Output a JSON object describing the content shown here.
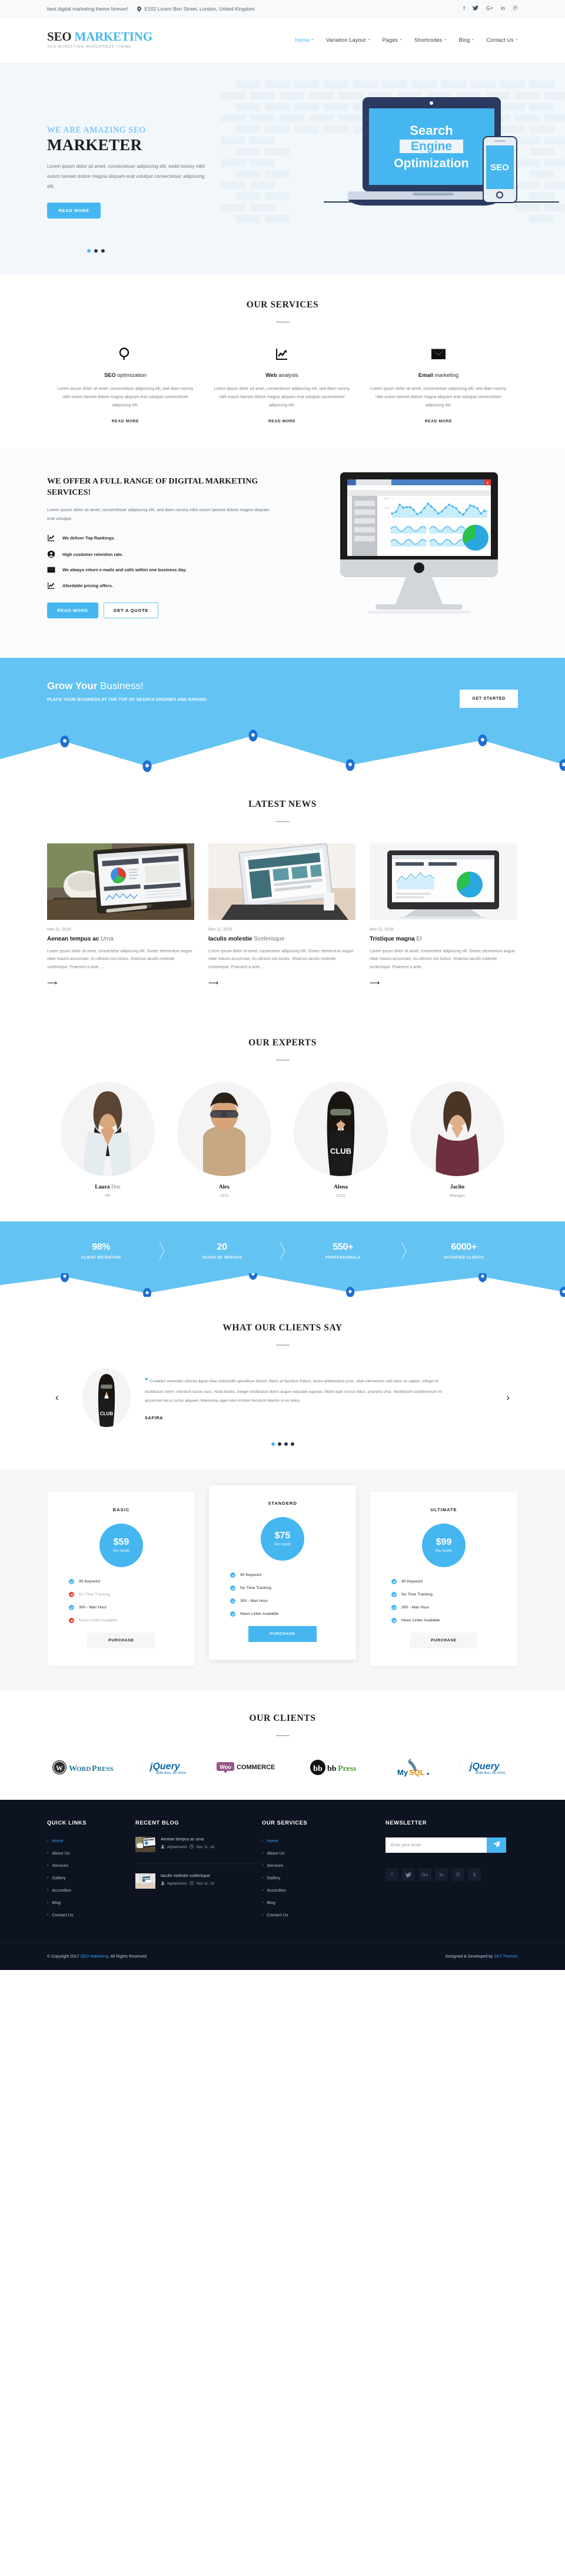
{
  "topbar": {
    "tagline": "best digital marketing theme forever!",
    "address": "E102 Lorem Ben Street, London, United Kingdom",
    "social": [
      {
        "name": "facebook-icon",
        "glyph": "f"
      },
      {
        "name": "twitter-icon",
        "glyph": "✉"
      },
      {
        "name": "google-plus-icon",
        "glyph": "G+"
      },
      {
        "name": "linkedin-icon",
        "glyph": "in"
      },
      {
        "name": "pinterest-icon",
        "glyph": "Ⓟ"
      }
    ]
  },
  "header": {
    "logo_main": "SEO ",
    "logo_accent": "MARKETING",
    "logo_sub": "SEO MARKETING WORDPRESS THEME",
    "nav": [
      {
        "label": "Home",
        "active": true,
        "caret": true
      },
      {
        "label": "Variation Layout",
        "active": false,
        "caret": true
      },
      {
        "label": "Pages",
        "active": false,
        "caret": true
      },
      {
        "label": "Shortcodes",
        "active": false,
        "caret": true
      },
      {
        "label": "Blog",
        "active": false,
        "caret": true
      },
      {
        "label": "Contact Us",
        "active": false,
        "caret": true
      }
    ]
  },
  "hero": {
    "kicker": "WE ARE AMAZING SEO",
    "title": "MARKETER",
    "paragraph": "Lorem ipsum dolor sit amet, consectetuer adipiscing elit, sedd nonmy nibh euism laoreet dolore magna aliquam erat volutpat consectetuer adipiscing elit.",
    "cta": "READ MORE",
    "art_line1": "Search",
    "art_line2": "Engine",
    "art_line3": "Optimization",
    "art_phone": "SEO",
    "slides": 3,
    "active_slide": 1
  },
  "services": {
    "title": "OUR SERVICES",
    "items": [
      {
        "icon": "search-icon",
        "title_bold": "SEO",
        "title_rest": " optimization",
        "text": "Lorem ipsum dolor sit amet, consectetuer adipiscing elit, sed diam nonmy nibh euism laoreet dolore magna aliquam erat volutpat consectetuer adipiscing elit.",
        "link": "READ MORE"
      },
      {
        "icon": "chart-line-icon",
        "title_bold": "Web",
        "title_rest": " analysis",
        "text": "Lorem ipsum dolor sit amet, consectetuer adipiscing elit, sed diam nonmy nibh euism laoreet dolore magna aliquam erat volutpat consectetuer adipiscing elit.",
        "link": "READ MORE"
      },
      {
        "icon": "envelope-icon",
        "title_bold": "Email",
        "title_rest": " marketing",
        "text": "Lorem ipsum dolor sit amet, consectetuer adipiscing elit, sed diam nonmy nibh euism laoreet dolore magna aliquam erat volutpat consectetuer adipiscing elit.",
        "link": "READ MORE"
      }
    ]
  },
  "fullrange": {
    "heading": "WE OFFER A FULL RANGE OF DIGITAL MARKETING SERVICES!",
    "paragraph": "Lorem ipsum dolor sit amet, consectetuer adipiscing elit, sed diam nonmy nibh euism laoreet dolore magna aliquam erat volutpat.",
    "points": [
      {
        "icon": "chart-line-icon",
        "text": "We deliver Top Rankings."
      },
      {
        "icon": "user-circle-icon",
        "text": "High customer retention rate."
      },
      {
        "icon": "envelope-icon",
        "text": "We always return e-mails and calls within one business day."
      },
      {
        "icon": "chart-line-icon",
        "text": "Afordable pricing offers."
      }
    ],
    "btn_primary": "READ MORE",
    "btn_secondary": "GET A QUOTE"
  },
  "grow": {
    "title_bold": "Grow Your ",
    "title_rest": "Business!",
    "subtitle": "PLACE YOUR BUSINESS AT THE TOP OF SEARCH ENGINES AND EXPAND.",
    "cta": "GET STARTED"
  },
  "news": {
    "title": "LATEST NEWS",
    "items": [
      {
        "date": "Nov 11, 2016",
        "title_bold": "Aenean tempus ac ",
        "title_rest": "Urna",
        "text": "Lorem ipsum dolor sit amet, consectetur adipiscing elit. Donec elementum augue vitae mauris accumsan, eu ultrices nisi luctus. Vivamus iaculis molestie scelerisque. Praesent a ante…"
      },
      {
        "date": "Nov 11, 2016",
        "title_bold": "Iaculis molestie ",
        "title_rest": "Scelerisque",
        "text": "Lorem ipsum dolor sit amet, consectetur adipiscing elit. Donec elementum augue vitae mauris accumsan, eu ultrices nisi luctus. Vivamus iaculis molestie scelerisque. Praesent a ante…"
      },
      {
        "date": "Nov 11, 2016",
        "title_bold": "Tristique magna ",
        "title_rest": "Et",
        "text": "Lorem ipsum dolor sit amet, consectetur adipiscing elit. Donec elementum augue vitae mauris accumsan, eu ultrices nisi luctus. Vivamus iaculis molestie scelerisque. Praesent a ante…"
      }
    ]
  },
  "experts": {
    "title": "OUR EXPERTS",
    "items": [
      {
        "name_bold": "Laura ",
        "name_rest": "Doe",
        "role": "HR"
      },
      {
        "name_bold": "Alex",
        "name_rest": "",
        "role": "CEO"
      },
      {
        "name_bold": "Alena",
        "name_rest": "",
        "role": "CCO"
      },
      {
        "name_bold": "Jaclin",
        "name_rest": "",
        "role": "Manager"
      }
    ]
  },
  "counters": [
    {
      "number": "98%",
      "label": "CLIENT RETENTION"
    },
    {
      "number": "20",
      "label": "YEARS OF SERVICE"
    },
    {
      "number": "550+",
      "label": "PROFESSIONALS"
    },
    {
      "number": "6000+",
      "label": "SATISFIED CLIENTS"
    }
  ],
  "testimonial": {
    "title": "WHAT OUR CLIENTS SAY",
    "quote": "Curabitur venenatis ultricies ligula vitae sollicitudin spendisse dictum, libero at faucibus finibus, lectus arbibendum justo, vitae elementum velit dolor ac sapien. Integer id vestibulum lorem, interdum luctus nunc. Nulla facilisi. Integer vestibulum libero augue vulputate egestas. Morbi eget cursus tellus, pharetra urna. Vestibulum condimentum mi accumsan lacus luctus aliquam. Maecenas eget nunc id dolor tincidunt lobortis ut eu tellus.",
    "author": "SAFIRA",
    "prev": "‹",
    "next": "›",
    "dots": 4,
    "active_dot": 1
  },
  "pricing": {
    "plans": [
      {
        "name": "BASIC",
        "amount": "$59",
        "per": "Per month",
        "featured": false,
        "features": [
          {
            "text": "90 Keyword",
            "ok": true
          },
          {
            "text": "No Time Tracking",
            "ok": false
          },
          {
            "text": "300 - Man Hour",
            "ok": true
          },
          {
            "text": "News Letter Available",
            "ok": false
          }
        ],
        "cta": "PURCHASE"
      },
      {
        "name": "STANDERD",
        "amount": "$75",
        "per": "Per month",
        "featured": true,
        "features": [
          {
            "text": "90 Keyword",
            "ok": true
          },
          {
            "text": "No Time Tracking",
            "ok": true
          },
          {
            "text": "300 - Man Hour",
            "ok": true
          },
          {
            "text": "News Letter Available",
            "ok": true
          }
        ],
        "cta": "PURCHASE"
      },
      {
        "name": "ULTIMATE",
        "amount": "$99",
        "per": "Per month",
        "featured": false,
        "features": [
          {
            "text": "90 Keyword",
            "ok": true
          },
          {
            "text": "No Time Tracking",
            "ok": true
          },
          {
            "text": "300 - Man Hour",
            "ok": true
          },
          {
            "text": "News Letter Available",
            "ok": true
          }
        ],
        "cta": "PURCHASE"
      }
    ]
  },
  "clients": {
    "title": "OUR CLIENTS",
    "logos": [
      "WordPress",
      "jQuery",
      "WooCommerce",
      "bbPress",
      "MySQL",
      "jQuery"
    ]
  },
  "footer": {
    "quick_links": {
      "heading": "QUICK LINKS",
      "items": [
        {
          "label": "Home",
          "active": true
        },
        {
          "label": "About Us",
          "active": false
        },
        {
          "label": "Services",
          "active": false
        },
        {
          "label": "Gallery",
          "active": false
        },
        {
          "label": "Accordion",
          "active": false
        },
        {
          "label": "Blog",
          "active": false
        },
        {
          "label": "Contact Us",
          "active": false
        }
      ]
    },
    "recent_blog": {
      "heading": "RECENT BLOG",
      "items": [
        {
          "title": "Aenean tempus ac urna",
          "author": "digitalmark1",
          "date": "Nov 11, 16"
        },
        {
          "title": "Iaculis molestie scelerisque",
          "author": "digitalmark1",
          "date": "Nov 11, 16"
        }
      ]
    },
    "our_services": {
      "heading": "OUR SERVICES",
      "items": [
        {
          "label": "Home",
          "active": true
        },
        {
          "label": "About Us",
          "active": false
        },
        {
          "label": "Services",
          "active": false
        },
        {
          "label": "Gallery",
          "active": false
        },
        {
          "label": "Accordion",
          "active": false
        },
        {
          "label": "Blog",
          "active": false
        },
        {
          "label": "Contact Us",
          "active": false
        }
      ]
    },
    "newsletter": {
      "heading": "NEWSLETTER",
      "placeholder": "Enter your email",
      "send_icon": "paper-plane-icon",
      "social": [
        {
          "name": "facebook-icon",
          "glyph": "f"
        },
        {
          "name": "twitter-icon",
          "glyph": "✉"
        },
        {
          "name": "google-plus-icon",
          "glyph": "G+"
        },
        {
          "name": "linkedin-icon",
          "glyph": "in"
        },
        {
          "name": "pinterest-icon",
          "glyph": "Ⓟ"
        },
        {
          "name": "skype-icon",
          "glyph": "S"
        }
      ]
    },
    "bottom": {
      "copy_pre": "© Copyright 2017 ",
      "copy_link": "SEO Marketing",
      "copy_post": ". All Rights Reserved",
      "credit_pre": "Designed & Developed by ",
      "credit_link": "SKT Themes"
    }
  },
  "colors": {
    "accent": "#45b6f0",
    "banner": "#63c3f3",
    "dark": "#0d1320",
    "hero_bg": "#f2f7fb"
  }
}
